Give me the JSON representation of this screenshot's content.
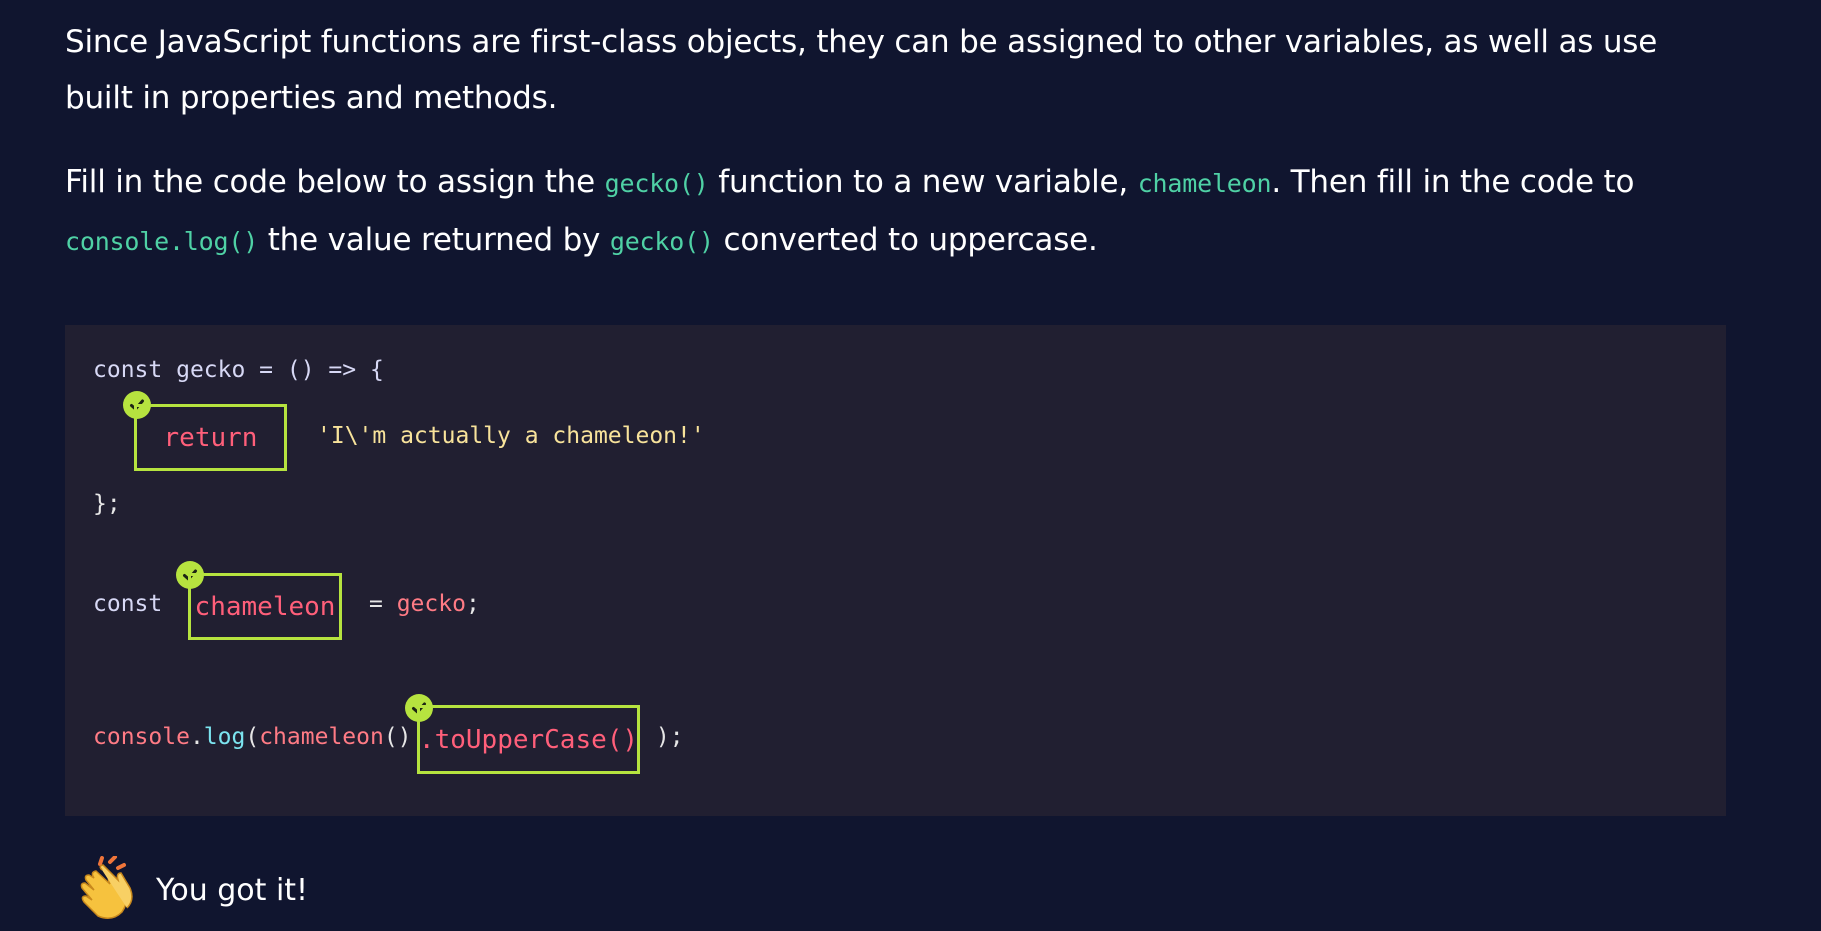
{
  "instructions": {
    "p1": "Since JavaScript functions are first-class objects, they can be assigned to other variables, as well as use built in properties and methods.",
    "p2_part1": "Fill in the code below to assign the ",
    "p2_code1": "gecko()",
    "p2_part2": " function to a new variable, ",
    "p2_code2": "chameleon",
    "p2_part3": ". Then fill in the code to ",
    "p2_code3": "console.log()",
    "p2_part4": " the value returned by ",
    "p2_code4": "gecko()",
    "p2_part5": " converted to uppercase."
  },
  "code": {
    "line1_const": "const",
    "line1_name": " gecko = () => {",
    "blank1": "return",
    "line2_string": "'I\\'m actually a chameleon!'",
    "line3": "};",
    "line4_const": "const",
    "blank2": "chameleon",
    "line4_eq": "= ",
    "line4_gecko": "gecko",
    "line4_semi": ";",
    "line5_console": "console",
    "line5_dot": ".",
    "line5_log": "log",
    "line5_paren": "(",
    "line5_chameleon": "chameleon",
    "line5_call": "()",
    "blank3": ".toUpperCase()",
    "line5_end": " );"
  },
  "feedback": {
    "text": "You got it!",
    "icon": "clapping-hands-icon"
  },
  "colors": {
    "background": "#10152f",
    "code_background": "#211f31",
    "inline_code": "#4fd1a5",
    "blank_border": "#b6e33f",
    "blank_text": "#ff5f7a",
    "string": "#f8e39b"
  }
}
